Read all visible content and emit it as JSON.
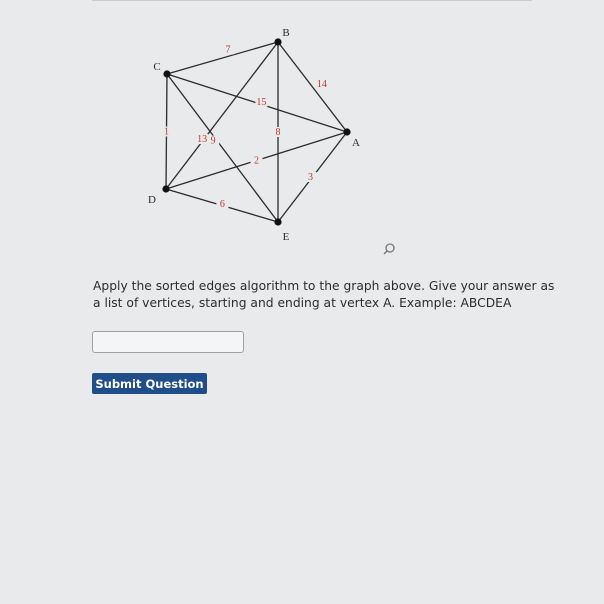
{
  "graph": {
    "vertices": [
      {
        "id": "A",
        "label": "A"
      },
      {
        "id": "B",
        "label": "B"
      },
      {
        "id": "C",
        "label": "C"
      },
      {
        "id": "D",
        "label": "D"
      },
      {
        "id": "E",
        "label": "E"
      }
    ],
    "edges": [
      {
        "from": "C",
        "to": "B",
        "weight": "7"
      },
      {
        "from": "B",
        "to": "A",
        "weight": "14"
      },
      {
        "from": "C",
        "to": "A",
        "weight": "15"
      },
      {
        "from": "B",
        "to": "D",
        "weight": "13"
      },
      {
        "from": "C",
        "to": "D",
        "weight": "1"
      },
      {
        "from": "B",
        "to": "E",
        "weight": "8"
      },
      {
        "from": "C",
        "to": "E",
        "weight": "9"
      },
      {
        "from": "D",
        "to": "A",
        "weight": "2"
      },
      {
        "from": "A",
        "to": "E",
        "weight": "3"
      },
      {
        "from": "D",
        "to": "E",
        "weight": "6"
      }
    ],
    "colors": {
      "edge": "#2b2b2b",
      "vertex": "#111111",
      "weight_label": "#c0392b"
    }
  },
  "search_icon": "magnifier-icon",
  "question": {
    "text": "Apply the sorted edges algorithm to the graph above. Give your answer as a list of vertices, starting and ending at vertex A. Example: ABCDEA"
  },
  "answer": {
    "value": "",
    "placeholder": ""
  },
  "submit": {
    "label": "Submit Question",
    "color": "#1f4e8a"
  }
}
